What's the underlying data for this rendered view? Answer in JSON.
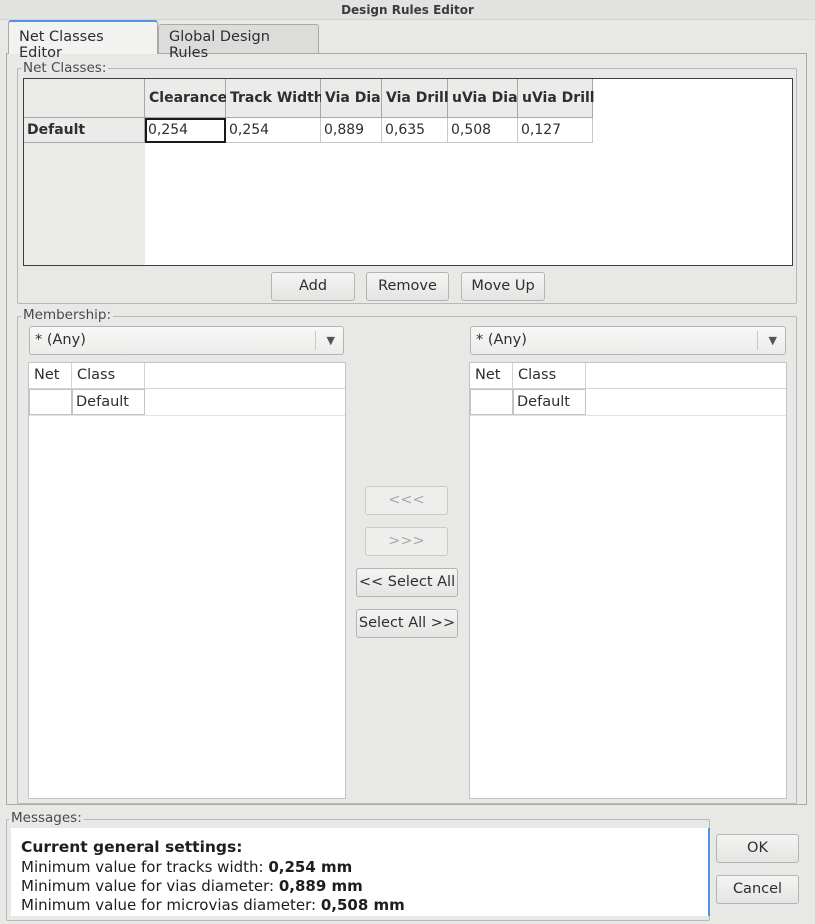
{
  "window": {
    "title": "Design Rules Editor"
  },
  "tabs": [
    {
      "label": "Net Classes Editor",
      "active": true
    },
    {
      "label": "Global Design Rules",
      "active": false
    }
  ],
  "net_classes": {
    "group_label": "Net Classes:",
    "columns": [
      "Clearance",
      "Track Width",
      "Via Dia",
      "Via Drill",
      "uVia Dia",
      "uVia Drill"
    ],
    "rows": [
      {
        "name": "Default",
        "values": [
          "0,254",
          "0,254",
          "0,889",
          "0,635",
          "0,508",
          "0,127"
        ]
      }
    ],
    "buttons": {
      "add": "Add",
      "remove": "Remove",
      "move_up": "Move Up"
    }
  },
  "membership": {
    "group_label": "Membership:",
    "left": {
      "filter": "* (Any)",
      "columns": [
        "Net",
        "Class"
      ],
      "rows": [
        {
          "net": "",
          "class": "Default"
        }
      ]
    },
    "right": {
      "filter": "* (Any)",
      "columns": [
        "Net",
        "Class"
      ],
      "rows": [
        {
          "net": "",
          "class": "Default"
        }
      ]
    },
    "buttons": {
      "move_left": "<<<",
      "move_right": ">>>",
      "select_all_left": "<< Select All",
      "select_all_right": "Select All >>"
    }
  },
  "messages": {
    "group_label": "Messages:",
    "heading": "Current general settings:",
    "lines": [
      {
        "label": "Minimum value for tracks width:",
        "value": "0,254 mm"
      },
      {
        "label": "Minimum value for vias diameter:",
        "value": "0,889 mm"
      },
      {
        "label": "Minimum value for microvias diameter:",
        "value": "0,508 mm"
      }
    ]
  },
  "dialog_buttons": {
    "ok": "OK",
    "cancel": "Cancel"
  },
  "colors": {
    "accent": "#5294e2",
    "window_bg": "#e8e8e7"
  }
}
